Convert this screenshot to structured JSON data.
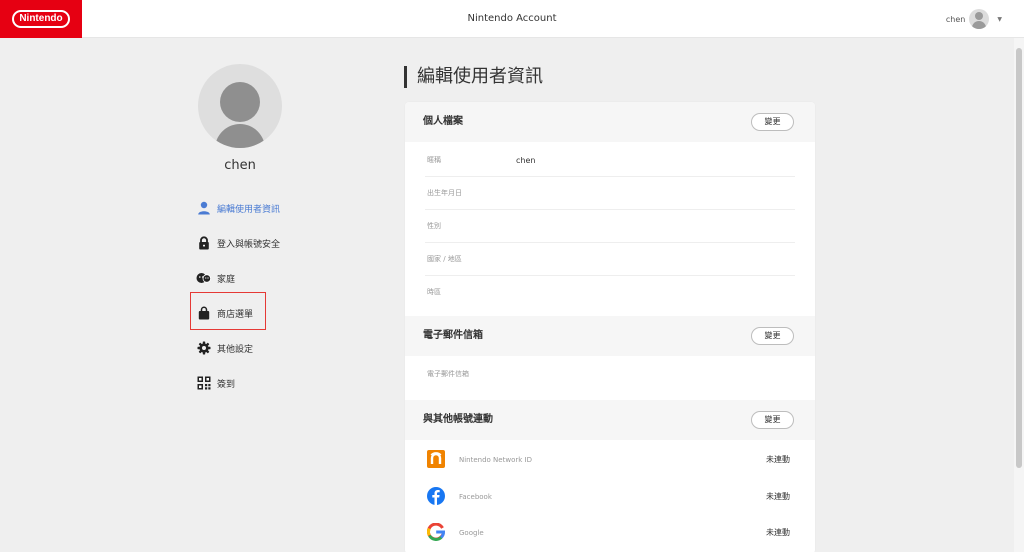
{
  "header": {
    "brand": "Nintendo",
    "title": "Nintendo Account",
    "username": "chen",
    "dropdown_icon": "chevron-down-icon",
    "brand_color": "#e60012"
  },
  "sidebar": {
    "profile_name": "chen",
    "active_color": "#4a7bd3",
    "items": [
      {
        "label": "編輯使用者資訊",
        "icon": "user-icon",
        "active": true
      },
      {
        "label": "登入與帳號安全",
        "icon": "lock-icon",
        "active": false
      },
      {
        "label": "家庭",
        "icon": "family-icon",
        "active": false
      },
      {
        "label": "商店選單",
        "icon": "shopping-bag-icon",
        "active": false,
        "highlighted": true
      },
      {
        "label": "其他設定",
        "icon": "gear-icon",
        "active": false
      },
      {
        "label": "簽到",
        "icon": "qr-code-icon",
        "active": false
      }
    ]
  },
  "main": {
    "page_title": "編輯使用者資訊",
    "profile": {
      "title": "個人檔案",
      "change_label": "變更",
      "fields": [
        {
          "label": "暱稱",
          "value": "chen"
        },
        {
          "label": "出生年月日",
          "value": ""
        },
        {
          "label": "性別",
          "value": ""
        },
        {
          "label": "國家 / 地區",
          "value": ""
        },
        {
          "label": "時區",
          "value": ""
        }
      ]
    },
    "email": {
      "title": "電子郵件信箱",
      "change_label": "變更",
      "field_label": "電子郵件信箱"
    },
    "linked": {
      "title": "與其他帳號連動",
      "change_label": "變更",
      "accounts": [
        {
          "name": "Nintendo Network ID",
          "status": "未連動",
          "icon": "nintendo-network-icon",
          "color": "#f08300"
        },
        {
          "name": "Facebook",
          "status": "未連動",
          "icon": "facebook-icon",
          "color": "#1877f2"
        },
        {
          "name": "Google",
          "status": "未連動",
          "icon": "google-icon",
          "color": "#4285f4"
        }
      ]
    }
  }
}
